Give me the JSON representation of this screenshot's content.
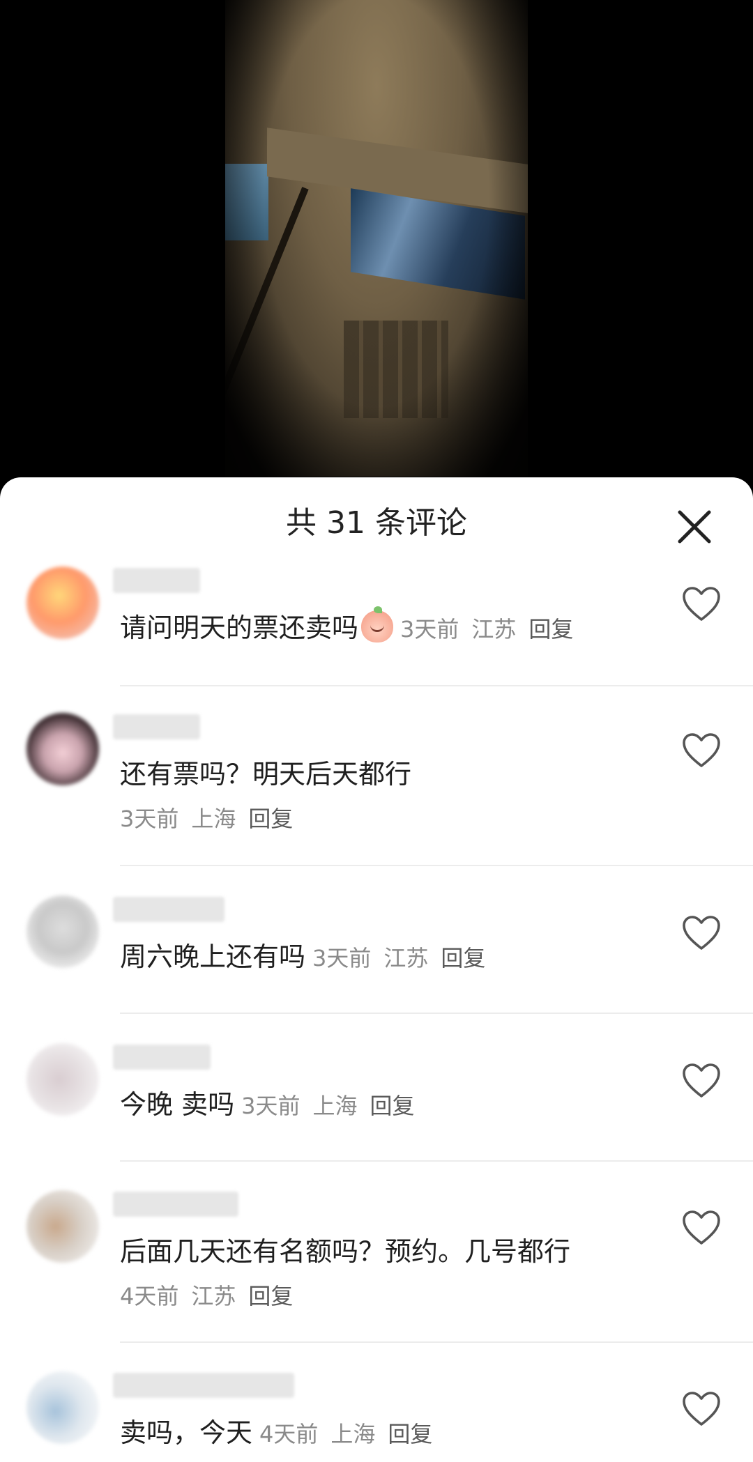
{
  "sheet": {
    "title": "共 31 条评论"
  },
  "comments": [
    {
      "text": "请问明天的票还卖吗",
      "emoji": "peach-face-emoji",
      "time": "3天前",
      "location": "江苏",
      "reply": "回复"
    },
    {
      "text": "还有票吗？明天后天都行",
      "time": "3天前",
      "location": "上海",
      "reply": "回复"
    },
    {
      "text": "周六晚上还有吗",
      "time": "3天前",
      "location": "江苏",
      "reply": "回复"
    },
    {
      "text": "今晚 卖吗",
      "time": "3天前",
      "location": "上海",
      "reply": "回复"
    },
    {
      "text": "后面几天还有名额吗？预约。几号都行",
      "time": "4天前",
      "location": "江苏",
      "reply": "回复"
    },
    {
      "text": "卖吗，今天",
      "time": "4天前",
      "location": "上海",
      "reply": "回复"
    }
  ],
  "icons": {
    "close": "close-icon",
    "like": "heart-outline-icon"
  },
  "colors": {
    "text_primary": "#1f1f1f",
    "text_meta": "#8a8a8a",
    "sheet_bg": "#ffffff",
    "video_bg": "#000000"
  }
}
